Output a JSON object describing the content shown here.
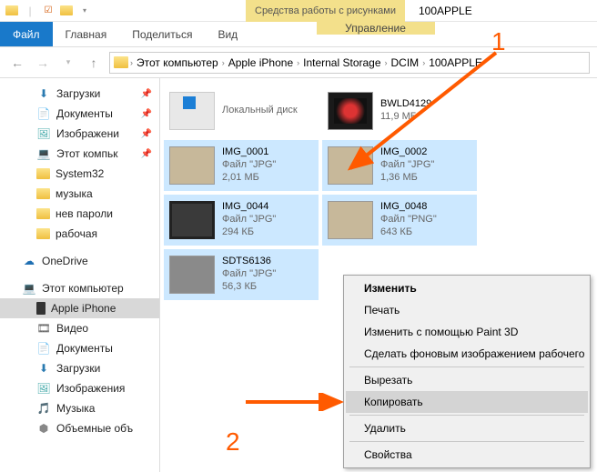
{
  "titlebar": {
    "context_tab": "Средства работы с рисунками",
    "window_title": "100APPLE"
  },
  "ribbon": {
    "file": "Файл",
    "tabs": [
      "Главная",
      "Поделиться",
      "Вид"
    ],
    "context": "Управление"
  },
  "breadcrumb": {
    "segments": [
      "Этот компьютер",
      "Apple iPhone",
      "Internal Storage",
      "DCIM",
      "100APPLE"
    ]
  },
  "tree": {
    "quick": [
      {
        "label": "Загрузки",
        "icon": "dl",
        "pin": true
      },
      {
        "label": "Документы",
        "icon": "doc",
        "pin": true
      },
      {
        "label": "Изображени",
        "icon": "img",
        "pin": true
      },
      {
        "label": "Этот компьк",
        "icon": "pc",
        "pin": true
      },
      {
        "label": "System32",
        "icon": "folder"
      },
      {
        "label": "музыка",
        "icon": "folder"
      },
      {
        "label": "нев пароли",
        "icon": "folder"
      },
      {
        "label": "рабочая",
        "icon": "folder"
      }
    ],
    "onedrive": "OneDrive",
    "thispc": "Этот компьютер",
    "pc_children": [
      {
        "label": "Apple iPhone",
        "icon": "phone",
        "selected": true
      },
      {
        "label": "Видео",
        "icon": "vid"
      },
      {
        "label": "Документы",
        "icon": "doc"
      },
      {
        "label": "Загрузки",
        "icon": "dl"
      },
      {
        "label": "Изображения",
        "icon": "img"
      },
      {
        "label": "Музыка",
        "icon": "mus"
      },
      {
        "label": "Объемные объ",
        "icon": "drv"
      }
    ]
  },
  "files": [
    {
      "name": "",
      "type": "Локальный диск",
      "size": "",
      "thumb": "drive",
      "sel": false
    },
    {
      "name": "BWLD4129",
      "type": "",
      "size": "11,9 МБ",
      "thumb": "vid",
      "sel": false
    },
    {
      "name": "IMG_0001",
      "type": "Файл \"JPG\"",
      "size": "2,01 МБ",
      "thumb": "beige",
      "sel": true
    },
    {
      "name": "IMG_0002",
      "type": "Файл \"JPG\"",
      "size": "1,36 МБ",
      "thumb": "beige",
      "sel": true
    },
    {
      "name": "IMG_0044",
      "type": "Файл \"JPG\"",
      "size": "294 КБ",
      "thumb": "dark",
      "sel": true
    },
    {
      "name": "IMG_0048",
      "type": "Файл \"PNG\"",
      "size": "643 КБ",
      "thumb": "beige",
      "sel": true
    },
    {
      "name": "SDTS6136",
      "type": "Файл \"JPG\"",
      "size": "56,3 КБ",
      "thumb": "gray",
      "sel": true
    }
  ],
  "context_menu": {
    "items": [
      {
        "label": "Изменить",
        "bold": true
      },
      {
        "label": "Печать"
      },
      {
        "label": "Изменить с помощью Paint 3D"
      },
      {
        "label": "Сделать фоновым изображением рабочего стола",
        "clip": true
      },
      {
        "sep": true
      },
      {
        "label": "Вырезать"
      },
      {
        "label": "Копировать",
        "hover": true
      },
      {
        "sep": true
      },
      {
        "label": "Удалить"
      },
      {
        "sep": true
      },
      {
        "label": "Свойства"
      }
    ]
  },
  "annotations": {
    "one": "1",
    "two": "2"
  }
}
